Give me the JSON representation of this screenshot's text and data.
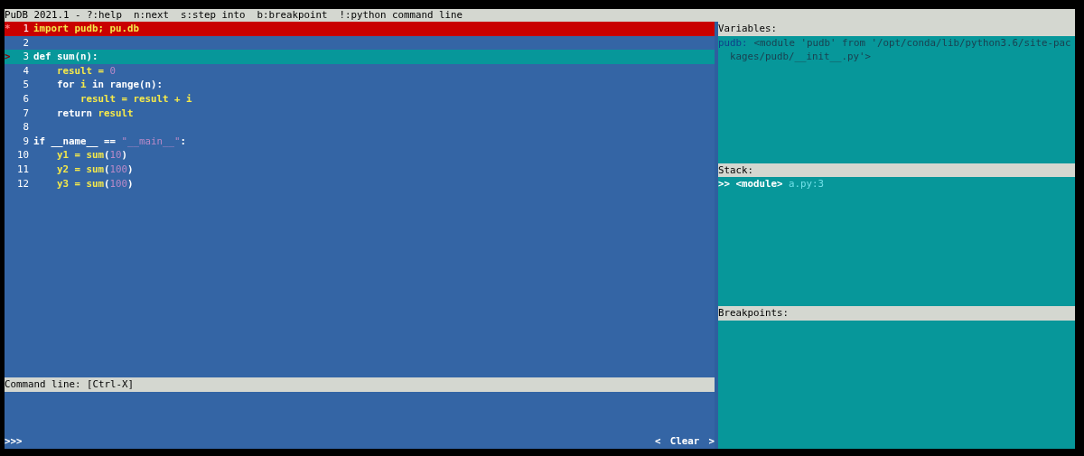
{
  "title_bar": {
    "text": "PuDB 2021.1 - ?:help  n:next  s:step into  b:breakpoint  !:python command line"
  },
  "source": {
    "lines": [
      {
        "number": "1",
        "marker": "*",
        "breakpoint": true,
        "current": false,
        "tokens": [
          {
            "text": "import pudb; pu.db",
            "kind": "name"
          }
        ]
      },
      {
        "number": "2",
        "breakpoint": false,
        "current": false
      },
      {
        "number": "3",
        "marker": ">",
        "breakpoint": false,
        "current": true,
        "tokens": [
          {
            "text": "def sum(n):",
            "kind": "keyword"
          }
        ]
      },
      {
        "number": "4",
        "breakpoint": false,
        "current": false,
        "tokens": [
          {
            "text": "    result = ",
            "kind": "name"
          },
          {
            "text": "0",
            "kind": "number"
          }
        ]
      },
      {
        "number": "5",
        "breakpoint": false,
        "current": false,
        "tokens": [
          {
            "text": "    for ",
            "kind": "keyword"
          },
          {
            "text": "i",
            "kind": "name"
          },
          {
            "text": " in range(n):",
            "kind": "keyword"
          }
        ]
      },
      {
        "number": "6",
        "breakpoint": false,
        "current": false,
        "tokens": [
          {
            "text": "        result = result + i",
            "kind": "name"
          }
        ]
      },
      {
        "number": "7",
        "breakpoint": false,
        "current": false,
        "tokens": [
          {
            "text": "    return ",
            "kind": "keyword"
          },
          {
            "text": "result",
            "kind": "name"
          }
        ]
      },
      {
        "number": "8",
        "breakpoint": false,
        "current": false
      },
      {
        "number": "9",
        "breakpoint": false,
        "current": false,
        "tokens": [
          {
            "text": "if __name__ == ",
            "kind": "keyword"
          },
          {
            "text": "\"__main__\"",
            "kind": "string"
          },
          {
            "text": ":",
            "kind": "keyword"
          }
        ]
      },
      {
        "number": "10",
        "breakpoint": false,
        "current": false,
        "tokens": [
          {
            "text": "    y1 = sum",
            "kind": "name"
          },
          {
            "text": "(",
            "kind": "keyword"
          },
          {
            "text": "10",
            "kind": "number"
          },
          {
            "text": ")",
            "kind": "keyword"
          }
        ]
      },
      {
        "number": "11",
        "breakpoint": false,
        "current": false,
        "tokens": [
          {
            "text": "    y2 = sum",
            "kind": "name"
          },
          {
            "text": "(",
            "kind": "keyword"
          },
          {
            "text": "100",
            "kind": "number"
          },
          {
            "text": ")",
            "kind": "keyword"
          }
        ]
      },
      {
        "number": "12",
        "breakpoint": false,
        "current": false,
        "tokens": [
          {
            "text": "    y3 = sum",
            "kind": "name"
          },
          {
            "text": "(",
            "kind": "keyword"
          },
          {
            "text": "100",
            "kind": "number"
          },
          {
            "text": ")",
            "kind": "keyword"
          }
        ]
      }
    ]
  },
  "command_line": {
    "header": "Command line: [Ctrl-X]",
    "prompt": ">>>",
    "clear_button": {
      "left": "<",
      "label": "Clear",
      "right": ">"
    }
  },
  "variables": {
    "header": "Variables:",
    "items": [
      {
        "name": "pudb:",
        "value_lines": [
          "<module 'pudb' from '/opt/conda/lib/python3.6/site-pac",
          "kages/pudb/__init__.py'>"
        ]
      }
    ]
  },
  "stack": {
    "header": "Stack:",
    "frames": [
      {
        "pointer": ">>",
        "function": "<module>",
        "location": "a.py:3",
        "selected": true
      }
    ]
  },
  "breakpoints": {
    "header": "Breakpoints:"
  }
}
